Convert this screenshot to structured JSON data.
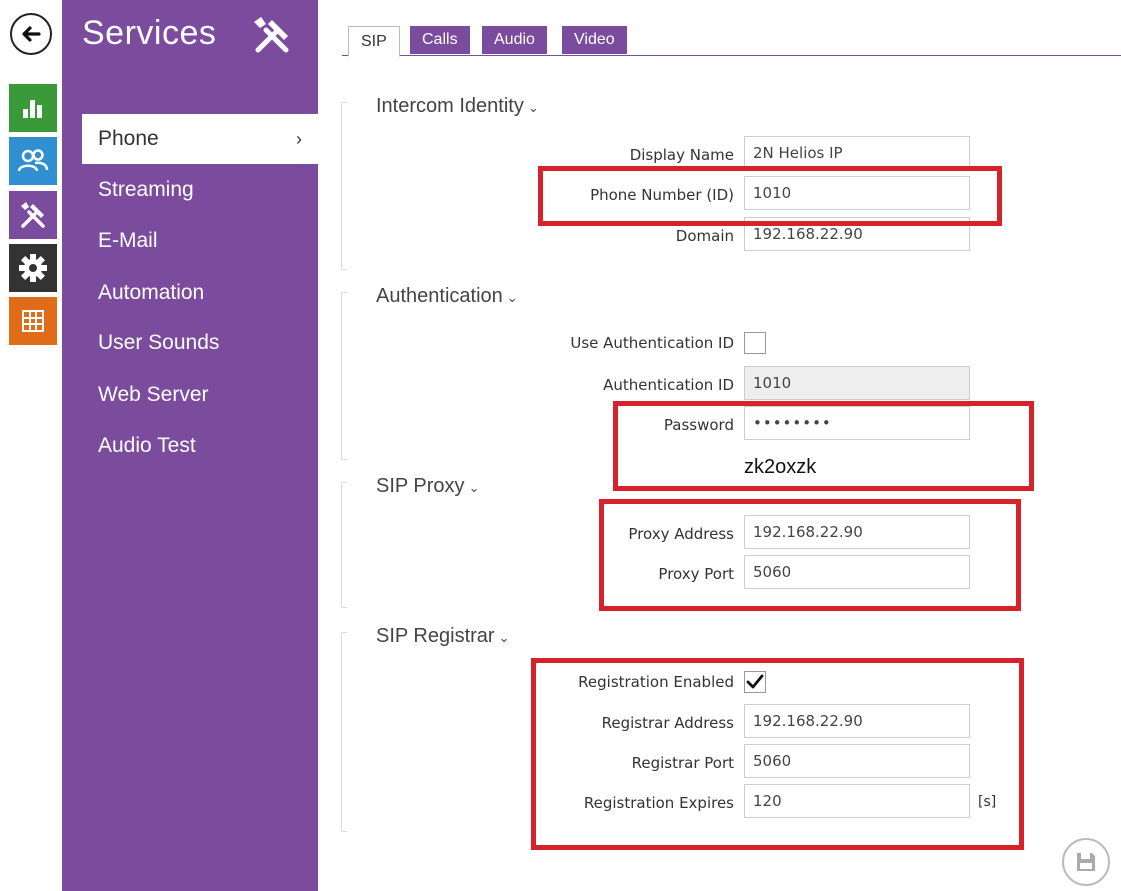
{
  "app": {
    "title": "Services",
    "icon": "tools-icon"
  },
  "rail": [
    {
      "name": "status",
      "icon": "bar-chart-icon",
      "color": "#3a9a3a"
    },
    {
      "name": "directory",
      "icon": "users-icon",
      "color": "#2f8fd0"
    },
    {
      "name": "services",
      "icon": "tools-icon",
      "color": "#7b4c9e"
    },
    {
      "name": "hardware",
      "icon": "gear-icon",
      "color": "#333333"
    },
    {
      "name": "system",
      "icon": "grid-icon",
      "color": "#e06c1a"
    }
  ],
  "sidebar": {
    "items": [
      {
        "label": "Phone",
        "active": true
      },
      {
        "label": "Streaming"
      },
      {
        "label": "E-Mail"
      },
      {
        "label": "Automation"
      },
      {
        "label": "User Sounds"
      },
      {
        "label": "Web Server"
      },
      {
        "label": "Audio Test"
      }
    ]
  },
  "tabs": [
    "SIP",
    "Calls",
    "Audio",
    "Video"
  ],
  "sections": {
    "identity": {
      "title": "Intercom Identity",
      "display_name_label": "Display Name",
      "display_name_value": "2N Helios IP",
      "phone_number_label": "Phone Number (ID)",
      "phone_number_value": "1010",
      "domain_label": "Domain",
      "domain_value": "192.168.22.90"
    },
    "auth": {
      "title": "Authentication",
      "use_auth_label": "Use Authentication ID",
      "use_auth_checked": false,
      "auth_id_label": "Authentication ID",
      "auth_id_value": "1010",
      "password_label": "Password",
      "password_value": "••••••••",
      "password_annotation": "zk2oxzk"
    },
    "proxy": {
      "title": "SIP Proxy",
      "address_label": "Proxy Address",
      "address_value": "192.168.22.90",
      "port_label": "Proxy Port",
      "port_value": "5060"
    },
    "registrar": {
      "title": "SIP Registrar",
      "enabled_label": "Registration Enabled",
      "enabled_checked": true,
      "address_label": "Registrar Address",
      "address_value": "192.168.22.90",
      "port_label": "Registrar Port",
      "port_value": "5060",
      "expires_label": "Registration Expires",
      "expires_value": "120",
      "expires_unit": "[s]"
    }
  },
  "colors": {
    "accent": "#7b4c9e",
    "highlight": "#d6222b"
  },
  "save_icon": "save-icon"
}
